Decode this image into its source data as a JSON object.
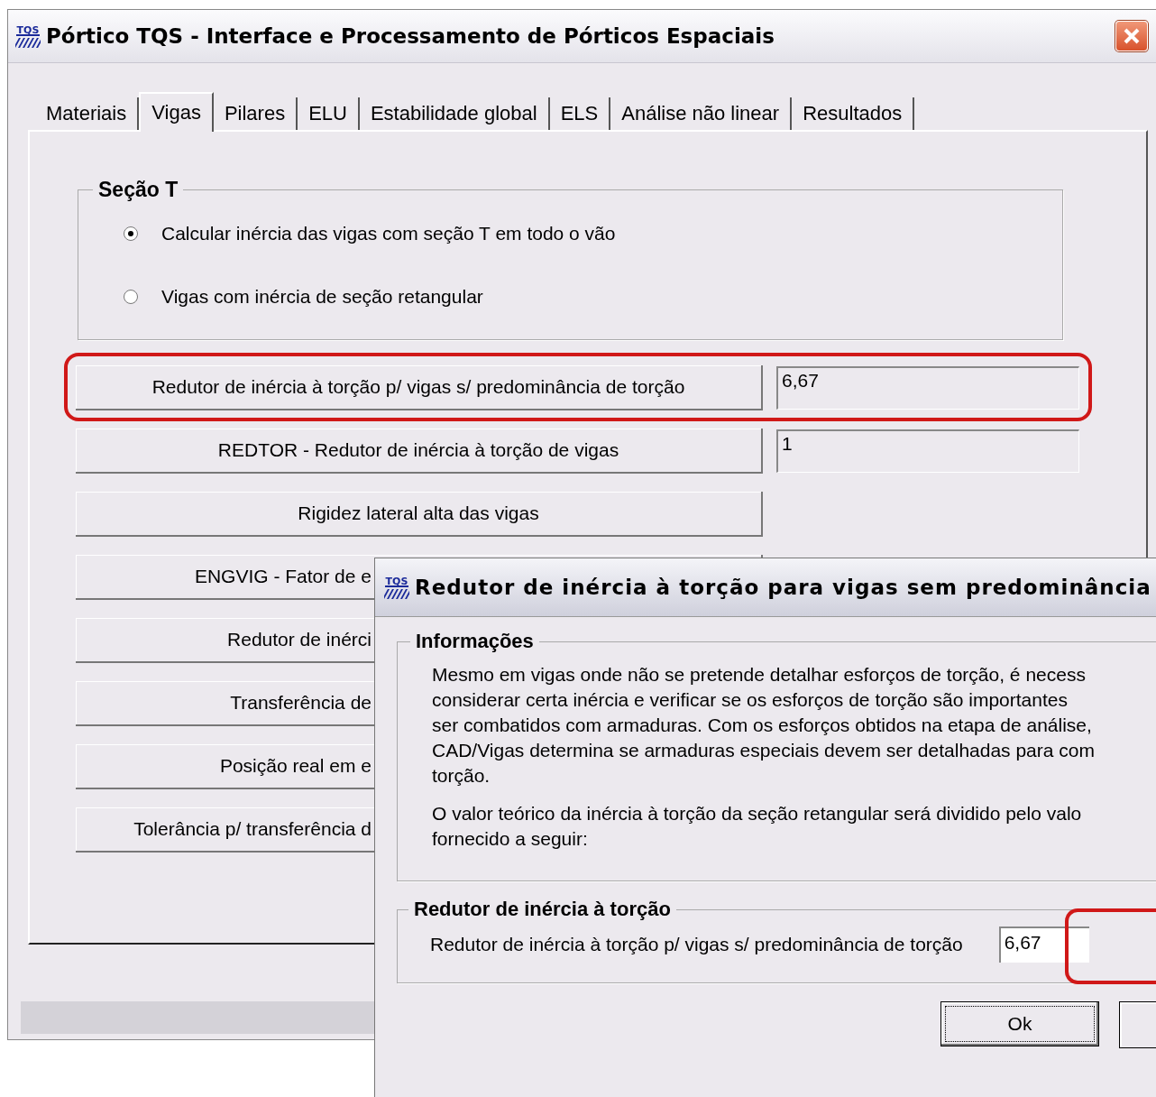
{
  "window": {
    "logo_text": "TQS",
    "title": "Pórtico TQS - Interface e Processamento de Pórticos Espaciais"
  },
  "tabs": [
    {
      "label": "Materiais",
      "selected": false
    },
    {
      "label": "Vigas",
      "selected": true
    },
    {
      "label": "Pilares",
      "selected": false
    },
    {
      "label": "ELU",
      "selected": false
    },
    {
      "label": "Estabilidade global",
      "selected": false
    },
    {
      "label": "ELS",
      "selected": false
    },
    {
      "label": "Análise não linear",
      "selected": false
    },
    {
      "label": "Resultados",
      "selected": false
    }
  ],
  "secao_t": {
    "title": "Seção T",
    "options": [
      {
        "label": "Calcular inércia das vigas com seção T em todo o vão",
        "selected": true
      },
      {
        "label": "Vigas com inércia de seção retangular",
        "selected": false
      }
    ]
  },
  "buttons": [
    {
      "label": "Redutor de inércia à torção p/ vigas s/ predominância de torção",
      "value": "6,67",
      "highlighted": true
    },
    {
      "label": "REDTOR - Redutor de inércia à torção de vigas",
      "value": "1",
      "highlighted": false
    },
    {
      "label": "Rigidez lateral alta das vigas"
    }
  ],
  "covered_buttons": [
    "ENGVIG - Fator de e",
    "Redutor de inérci",
    "Transferência de",
    "Posição real em e",
    "Tolerância p/ transferência d"
  ],
  "dialog": {
    "logo_text": "TQS",
    "title": "Redutor de inércia à torção para vigas sem predominância",
    "info_title": "Informações",
    "paragraphs": [
      [
        "Mesmo em vigas onde não se pretende detalhar esforços de torção, é necess",
        "considerar certa inércia  e verificar se os esforços de torção são importantes",
        "ser combatidos com armaduras. Com os esforços obtidos na etapa de análise,",
        "CAD/Vigas determina se armaduras especiais devem ser detalhadas para com",
        "torção."
      ],
      [
        "O valor teórico da inércia à torção da seção retangular será dividido pelo valo",
        "fornecido a seguir:"
      ]
    ],
    "group_title": "Redutor de inércia à torção",
    "field_label": "Redutor de inércia à torção p/ vigas s/ predominância de torção",
    "field_value": "6,67",
    "ok": "Ok"
  }
}
